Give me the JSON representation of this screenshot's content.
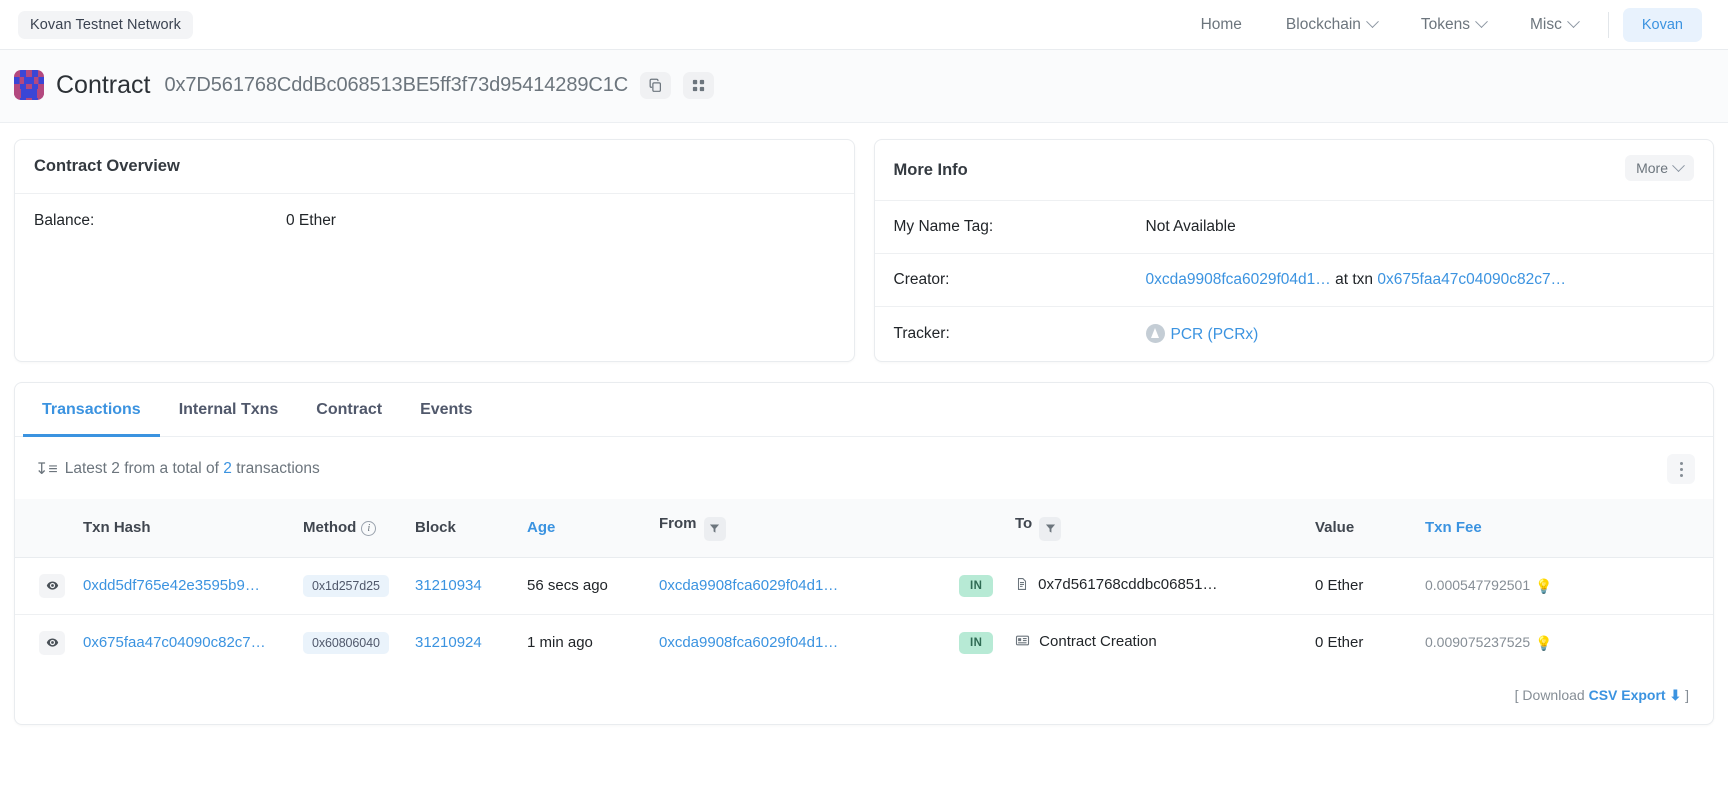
{
  "topnav": {
    "network_pill": "Kovan Testnet Network",
    "items": [
      {
        "label": "Home",
        "has_caret": false
      },
      {
        "label": "Blockchain",
        "has_caret": true
      },
      {
        "label": "Tokens",
        "has_caret": true
      },
      {
        "label": "Misc",
        "has_caret": true
      }
    ],
    "network_button": "Kovan"
  },
  "page_header": {
    "title": "Contract",
    "address": "0x7D561768CddBc068513BE5ff3f73d95414289C1C",
    "copy_icon": "copy-icon",
    "qr_icon": "qr-code-icon"
  },
  "contract_overview": {
    "title": "Contract Overview",
    "balance_label": "Balance:",
    "balance_value": "0 Ether"
  },
  "more_info": {
    "title": "More Info",
    "more_button": "More",
    "name_tag_label": "My Name Tag:",
    "name_tag_value": "Not Available",
    "creator_label": "Creator:",
    "creator_address": "0xcda9908fca6029f04d1…",
    "creator_sep": " at txn ",
    "creator_txn": "0x675faa47c04090c82c7…",
    "tracker_label": "Tracker:",
    "tracker_value": "PCR (PCRx)"
  },
  "txn_panel": {
    "tabs": [
      {
        "label": "Transactions",
        "active": true
      },
      {
        "label": "Internal Txns",
        "active": false
      },
      {
        "label": "Contract",
        "active": false
      },
      {
        "label": "Events",
        "active": false
      }
    ],
    "summary_prefix": "Latest 2 from a total of ",
    "summary_count": "2",
    "summary_suffix": " transactions",
    "columns": {
      "txn_hash": "Txn Hash",
      "method": "Method",
      "block": "Block",
      "age": "Age",
      "from": "From",
      "to": "To",
      "value": "Value",
      "txn_fee": "Txn Fee"
    },
    "rows": [
      {
        "hash": "0xdd5df765e42e3595b9…",
        "method": "0x1d257d25",
        "block": "31210934",
        "age": "56 secs ago",
        "from": "0xcda9908fca6029f04d1…",
        "direction": "IN",
        "to": "0x7d561768cddbc06851…",
        "to_is_creation": false,
        "value": "0 Ether",
        "fee": "0.000547792501"
      },
      {
        "hash": "0x675faa47c04090c82c7…",
        "method": "0x60806040",
        "block": "31210924",
        "age": "1 min ago",
        "from": "0xcda9908fca6029f04d1…",
        "direction": "IN",
        "to": "Contract Creation",
        "to_is_creation": true,
        "value": "0 Ether",
        "fee": "0.009075237525"
      }
    ],
    "footer_open": "[ Download ",
    "footer_link": "CSV Export",
    "footer_close": " ]"
  },
  "colors": {
    "link": "#3b93e0",
    "accent": "#3b93e0",
    "in_badge_bg": "#b7ead5",
    "in_badge_text": "#2f6b54",
    "method_badge_bg": "#eaf3fb"
  }
}
